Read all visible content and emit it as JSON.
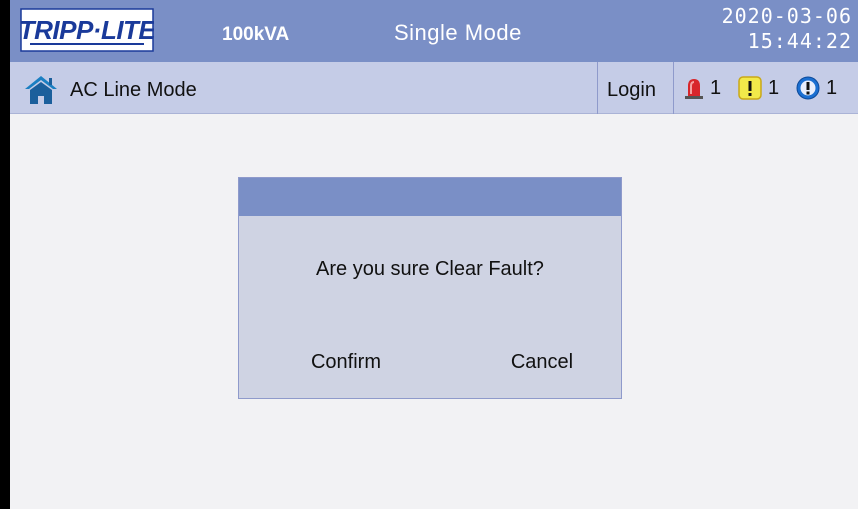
{
  "header": {
    "logo_text": "TRIPP·LITE",
    "capacity": "100kVA",
    "mode": "Single Mode",
    "date": "2020-03-06",
    "time": "15:44:22"
  },
  "statusbar": {
    "home_icon": "home-icon",
    "status": "AC Line Mode",
    "login_label": "Login",
    "alarms": [
      {
        "icon": "siren-icon",
        "count": "1"
      },
      {
        "icon": "warning-icon",
        "count": "1"
      },
      {
        "icon": "info-icon",
        "count": "1"
      }
    ]
  },
  "dialog": {
    "message": "Are you sure Clear Fault?",
    "confirm_label": "Confirm",
    "cancel_label": "Cancel"
  },
  "colors": {
    "header_bg": "#7a8fc6",
    "subbar_bg": "#c5cce7",
    "dialog_bg": "#cfd3e3",
    "logo_blue": "#1a3a9a"
  }
}
